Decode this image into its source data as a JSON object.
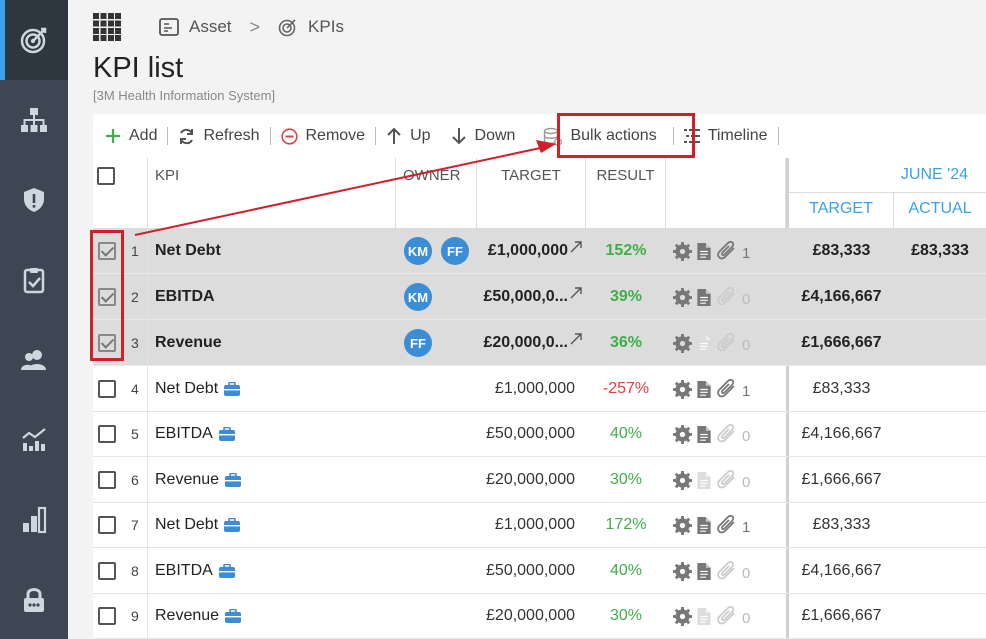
{
  "breadcrumb": {
    "item1": "Asset",
    "item2": "KPIs",
    "separator": ">"
  },
  "page": {
    "title": "KPI list",
    "subtitle": "[3M Health Information System]"
  },
  "toolbar": {
    "add": "Add",
    "refresh": "Refresh",
    "remove": "Remove",
    "up": "Up",
    "down": "Down",
    "bulk": "Bulk actions",
    "timeline": "Timeline"
  },
  "table": {
    "headers": {
      "kpi": "KPI",
      "owner": "OWNER",
      "target": "TARGET",
      "result": "RESULT"
    },
    "month": {
      "label": "JUNE '24",
      "target": "TARGET",
      "actual": "ACTUAL"
    },
    "rows": [
      {
        "num": "1",
        "kpi": "Net Debt",
        "owners": [
          "KM",
          "FF"
        ],
        "target": "£1,000,000",
        "result": "152%",
        "status": "pos",
        "attachments": "1",
        "doc": true,
        "clip": true,
        "m_target": "£83,333",
        "m_actual": "£83,333",
        "selected": true,
        "brief": false
      },
      {
        "num": "2",
        "kpi": "EBITDA",
        "owners": [
          "KM"
        ],
        "target": "£50,000,0...",
        "result": "39%",
        "status": "pos",
        "attachments": "0",
        "doc": true,
        "clip": false,
        "m_target": "£4,166,667",
        "m_actual": "",
        "selected": true,
        "brief": false
      },
      {
        "num": "3",
        "kpi": "Revenue",
        "owners": [
          "FF"
        ],
        "target": "£20,000,0...",
        "result": "36%",
        "status": "pos",
        "attachments": "0",
        "doc": false,
        "clip": false,
        "m_target": "£1,666,667",
        "m_actual": "",
        "selected": true,
        "brief": false
      },
      {
        "num": "4",
        "kpi": "Net Debt",
        "owners": [],
        "target": "£1,000,000",
        "result": "-257%",
        "status": "neg",
        "attachments": "1",
        "doc": true,
        "clip": true,
        "m_target": "£83,333",
        "m_actual": "",
        "selected": false,
        "brief": true
      },
      {
        "num": "5",
        "kpi": "EBITDA",
        "owners": [],
        "target": "£50,000,000",
        "result": "40%",
        "status": "pos",
        "attachments": "0",
        "doc": true,
        "clip": false,
        "m_target": "£4,166,667",
        "m_actual": "",
        "selected": false,
        "brief": true
      },
      {
        "num": "6",
        "kpi": "Revenue",
        "owners": [],
        "target": "£20,000,000",
        "result": "30%",
        "status": "pos",
        "attachments": "0",
        "doc": false,
        "clip": false,
        "m_target": "£1,666,667",
        "m_actual": "",
        "selected": false,
        "brief": true
      },
      {
        "num": "7",
        "kpi": "Net Debt",
        "owners": [],
        "target": "£1,000,000",
        "result": "172%",
        "status": "pos",
        "attachments": "1",
        "doc": true,
        "clip": true,
        "m_target": "£83,333",
        "m_actual": "",
        "selected": false,
        "brief": true
      },
      {
        "num": "8",
        "kpi": "EBITDA",
        "owners": [],
        "target": "£50,000,000",
        "result": "40%",
        "status": "pos",
        "attachments": "0",
        "doc": true,
        "clip": false,
        "m_target": "£4,166,667",
        "m_actual": "",
        "selected": false,
        "brief": true
      },
      {
        "num": "9",
        "kpi": "Revenue",
        "owners": [],
        "target": "£20,000,000",
        "result": "30%",
        "status": "pos",
        "attachments": "0",
        "doc": false,
        "clip": false,
        "m_target": "£1,666,667",
        "m_actual": "",
        "selected": false,
        "brief": true
      }
    ]
  },
  "colors": {
    "sidebar": "#3d4652",
    "accent": "#3aa0e8",
    "avatar": "#3b8dd6",
    "positive": "#3fae49",
    "negative": "#e04040",
    "annotation": "#d0202a"
  }
}
